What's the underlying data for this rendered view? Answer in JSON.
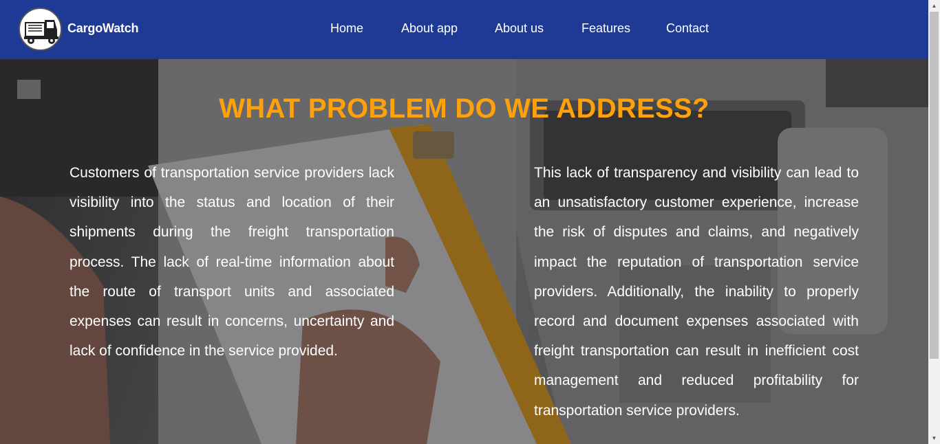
{
  "header": {
    "brand": "CargoWatch",
    "logo_icon": "truck-icon",
    "bg_color": "#1e3a94",
    "nav": [
      {
        "label": "Home"
      },
      {
        "label": "About app"
      },
      {
        "label": "About us"
      },
      {
        "label": "Features"
      },
      {
        "label": "Contact"
      }
    ]
  },
  "main": {
    "title": "WHAT PROBLEM DO WE ADDRESS?",
    "title_color": "#ffa10a",
    "left_text": "Customers of transportation service providers lack visibility into the status and location of their shipments during the freight transportation process. The lack of real-time information about the route of transport units and associated expenses can result in concerns, uncertainty and lack of confidence in the service provided.",
    "right_text": "This lack of transparency and visibility can lead to an unsatisfactory customer experience, increase the risk of disputes and claims, and negatively impact the reputation of transportation service providers. Additionally, the inability to properly record and document expenses associated with freight transportation can result in inefficient cost management and reduced profitability for transportation service providers."
  }
}
